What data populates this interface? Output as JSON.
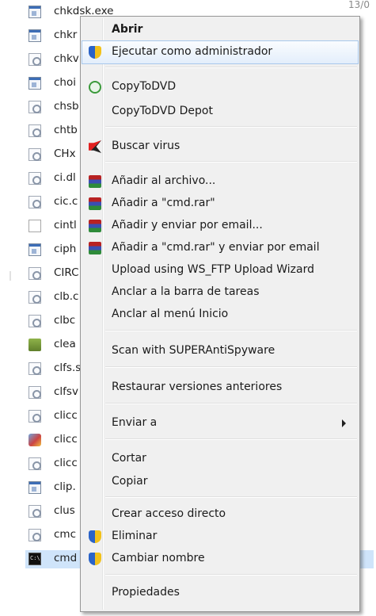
{
  "file_list": {
    "header_date": "13/0",
    "files": [
      {
        "name": "chkdsk.exe",
        "icon": "exe-file-icon"
      },
      {
        "name": "chkr",
        "icon": "exe-file-icon"
      },
      {
        "name": "chkv",
        "icon": "dll-file-icon"
      },
      {
        "name": "choi",
        "icon": "exe-file-icon"
      },
      {
        "name": "chsb",
        "icon": "dll-file-icon"
      },
      {
        "name": "chtb",
        "icon": "dll-file-icon"
      },
      {
        "name": "CHx",
        "icon": "dll-file-icon"
      },
      {
        "name": "ci.dl",
        "icon": "dll-file-icon"
      },
      {
        "name": "cic.c",
        "icon": "dll-file-icon"
      },
      {
        "name": "cintl",
        "icon": "blank-file-icon"
      },
      {
        "name": "ciph",
        "icon": "exe-file-icon"
      },
      {
        "name": "CIRC",
        "icon": "dll-file-icon"
      },
      {
        "name": "clb.c",
        "icon": "dll-file-icon"
      },
      {
        "name": "clbc",
        "icon": "dll-file-icon"
      },
      {
        "name": "clea",
        "icon": "cleanmgr-icon"
      },
      {
        "name": "clfs.s",
        "icon": "dll-file-icon"
      },
      {
        "name": "clfsv",
        "icon": "dll-file-icon"
      },
      {
        "name": "clicc",
        "icon": "dll-file-icon"
      },
      {
        "name": "clicc",
        "icon": "cliconfg-icon"
      },
      {
        "name": "clicc",
        "icon": "dll-file-icon"
      },
      {
        "name": "clip.",
        "icon": "exe-file-icon"
      },
      {
        "name": "clus",
        "icon": "dll-file-icon"
      },
      {
        "name": "cmc",
        "icon": "dll-file-icon"
      },
      {
        "name": "cmd",
        "icon": "cmd-icon"
      }
    ]
  },
  "context_menu": {
    "items": {
      "abrir": "Abrir",
      "ejecutar_admin": "Ejecutar como administrador",
      "copytodvd": "CopyToDVD",
      "copytodvd_depot": "CopyToDVD Depot",
      "buscar_virus": "Buscar virus",
      "anadir_archivo": "Añadir al archivo...",
      "anadir_cmd_rar": "Añadir a \"cmd.rar\"",
      "anadir_enviar_email": "Añadir y enviar por email...",
      "anadir_cmd_rar_email": "Añadir a \"cmd.rar\" y enviar por email",
      "upload_ws_ftp": "Upload using WS_FTP Upload Wizard",
      "anclar_tareas": "Anclar a la barra de tareas",
      "anclar_inicio": "Anclar al menú Inicio",
      "scan_superantispyware": "Scan with SUPERAntiSpyware",
      "restaurar_versiones": "Restaurar versiones anteriores",
      "enviar_a": "Enviar a",
      "cortar": "Cortar",
      "copiar": "Copiar",
      "crear_acceso_directo": "Crear acceso directo",
      "eliminar": "Eliminar",
      "cambiar_nombre": "Cambiar nombre",
      "propiedades": "Propiedades"
    },
    "highlighted": "ejecutar_admin",
    "highlight_color": "#cfe2f8",
    "menu_background": "#f0f0f0"
  }
}
